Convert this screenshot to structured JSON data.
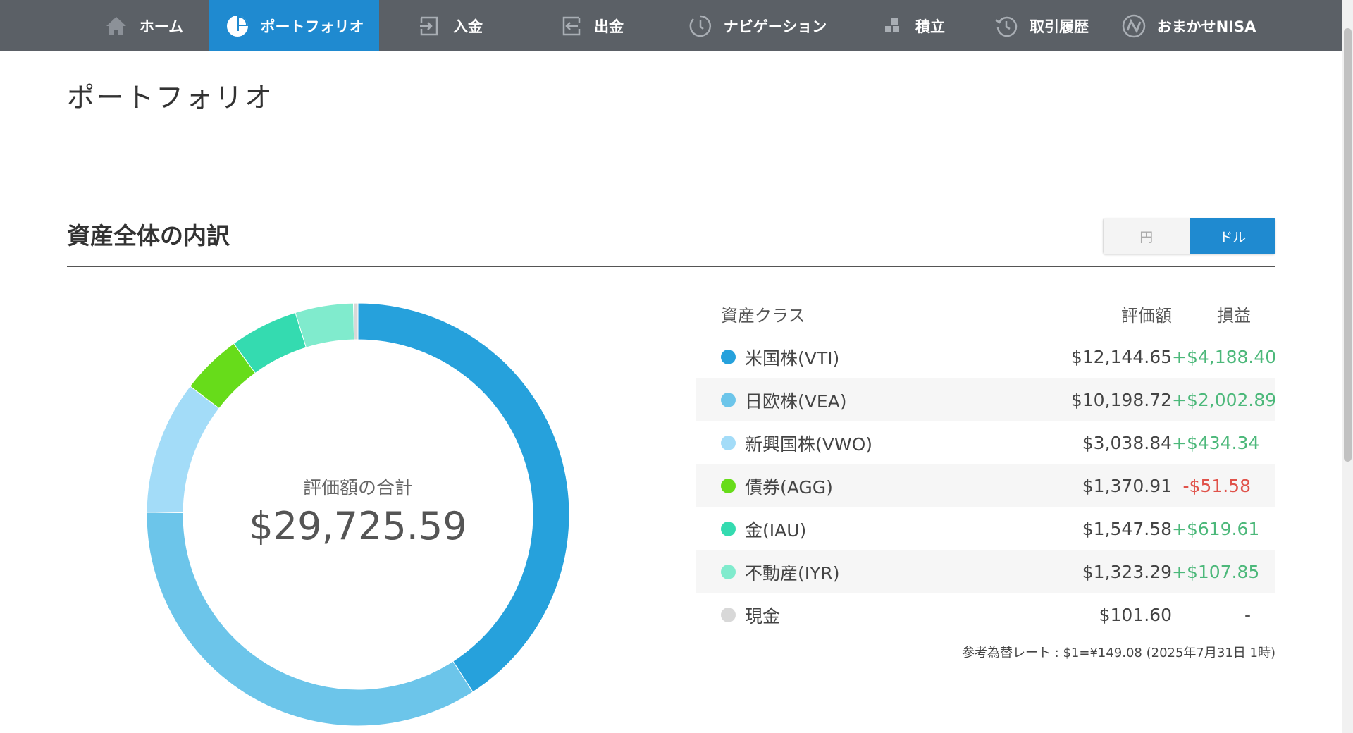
{
  "nav": {
    "items": [
      {
        "label": "ホーム",
        "icon": "home-icon",
        "active": false
      },
      {
        "label": "ポートフォリオ",
        "icon": "pie-chart-icon",
        "active": true
      },
      {
        "label": "入金",
        "icon": "deposit-icon",
        "active": false
      },
      {
        "label": "出金",
        "icon": "withdraw-icon",
        "active": false
      },
      {
        "label": "ナビゲーション",
        "icon": "navigation-clock-icon",
        "active": false
      },
      {
        "label": "積立",
        "icon": "blocks-icon",
        "active": false
      },
      {
        "label": "取引履歴",
        "icon": "history-icon",
        "active": false
      },
      {
        "label": "おまかせNISA",
        "icon": "nisa-logo-icon",
        "active": false
      }
    ]
  },
  "page": {
    "title": "ポートフォリオ",
    "section_title": "資産全体の内訳"
  },
  "currency_toggle": {
    "yen_label": "円",
    "dollar_label": "ドル",
    "selected": "ドル"
  },
  "summary": {
    "total_label": "評価額の合計",
    "total_value": "$29,725.59"
  },
  "table": {
    "headers": {
      "asset_class": "資産クラス",
      "value": "評価額",
      "pl": "損益"
    },
    "rows": [
      {
        "name": "米国株(VTI)",
        "value": "$12,144.65",
        "pl": "+$4,188.40",
        "pl_sign": "pos",
        "color": "#26a1dc"
      },
      {
        "name": "日欧株(VEA)",
        "value": "$10,198.72",
        "pl": "+$2,002.89",
        "pl_sign": "pos",
        "color": "#6cc5ea"
      },
      {
        "name": "新興国株(VWO)",
        "value": "$3,038.84",
        "pl": "+$434.34",
        "pl_sign": "pos",
        "color": "#a3dcf8"
      },
      {
        "name": "債券(AGG)",
        "value": "$1,370.91",
        "pl": "-$51.58",
        "pl_sign": "neg",
        "color": "#67dc1a"
      },
      {
        "name": "金(IAU)",
        "value": "$1,547.58",
        "pl": "+$619.61",
        "pl_sign": "pos",
        "color": "#34dbb0"
      },
      {
        "name": "不動産(IYR)",
        "value": "$1,323.29",
        "pl": "+$107.85",
        "pl_sign": "pos",
        "color": "#80ebcd"
      },
      {
        "name": "現金",
        "value": "$101.60",
        "pl": "-",
        "pl_sign": "neutral",
        "color": "#d8d8d8"
      }
    ]
  },
  "rate_note": "参考為替レート : $1=¥149.08 (2025年7月31日 1時)",
  "chart_data": {
    "type": "pie",
    "categories": [
      "米国株(VTI)",
      "日欧株(VEA)",
      "新興国株(VWO)",
      "債券(AGG)",
      "金(IAU)",
      "不動産(IYR)",
      "現金"
    ],
    "values": [
      12144.65,
      10198.72,
      3038.84,
      1370.91,
      1547.58,
      1323.29,
      101.6
    ],
    "colors": [
      "#26a1dc",
      "#6cc5ea",
      "#a3dcf8",
      "#67dc1a",
      "#34dbb0",
      "#80ebcd",
      "#d8d8d8"
    ],
    "title": "",
    "donut": true
  }
}
